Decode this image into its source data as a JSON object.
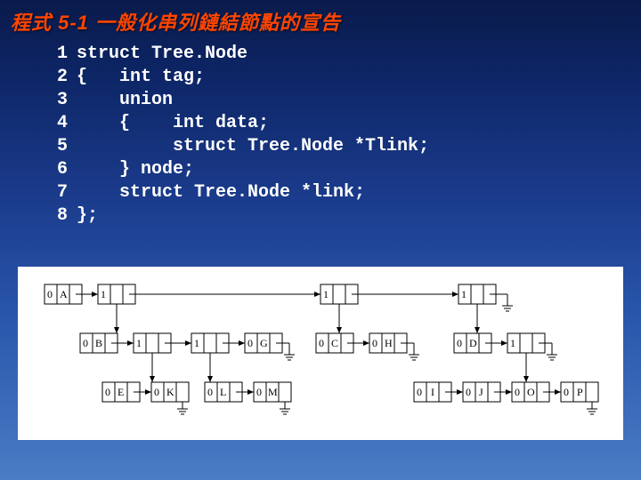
{
  "title": "程式 5-1  一般化串列鏈結節點的宣告",
  "code": {
    "l1": "struct Tree.Node",
    "l2": "{   int tag;",
    "l3": "    union",
    "l4": "    {    int data;",
    "l5": "         struct Tree.Node *Tlink;",
    "l6": "    } node;",
    "l7": "    struct Tree.Node *link;",
    "l8": "};"
  },
  "nodes": {
    "A": {
      "tag": "0",
      "data": "A"
    },
    "t1": {
      "tag": "1"
    },
    "t2": {
      "tag": "1"
    },
    "t3": {
      "tag": "1"
    },
    "B": {
      "tag": "0",
      "data": "B"
    },
    "t4": {
      "tag": "1"
    },
    "t5": {
      "tag": "1"
    },
    "G": {
      "tag": "0",
      "data": "G"
    },
    "C": {
      "tag": "0",
      "data": "C"
    },
    "H": {
      "tag": "0",
      "data": "H"
    },
    "D": {
      "tag": "0",
      "data": "D"
    },
    "t6": {
      "tag": "1"
    },
    "E": {
      "tag": "0",
      "data": "E"
    },
    "K": {
      "tag": "0",
      "data": "K"
    },
    "L": {
      "tag": "0",
      "data": "L"
    },
    "M": {
      "tag": "0",
      "data": "M"
    },
    "I": {
      "tag": "0",
      "data": "I"
    },
    "J": {
      "tag": "0",
      "data": "J"
    },
    "O": {
      "tag": "0",
      "data": "O"
    },
    "P": {
      "tag": "0",
      "data": "P"
    }
  }
}
